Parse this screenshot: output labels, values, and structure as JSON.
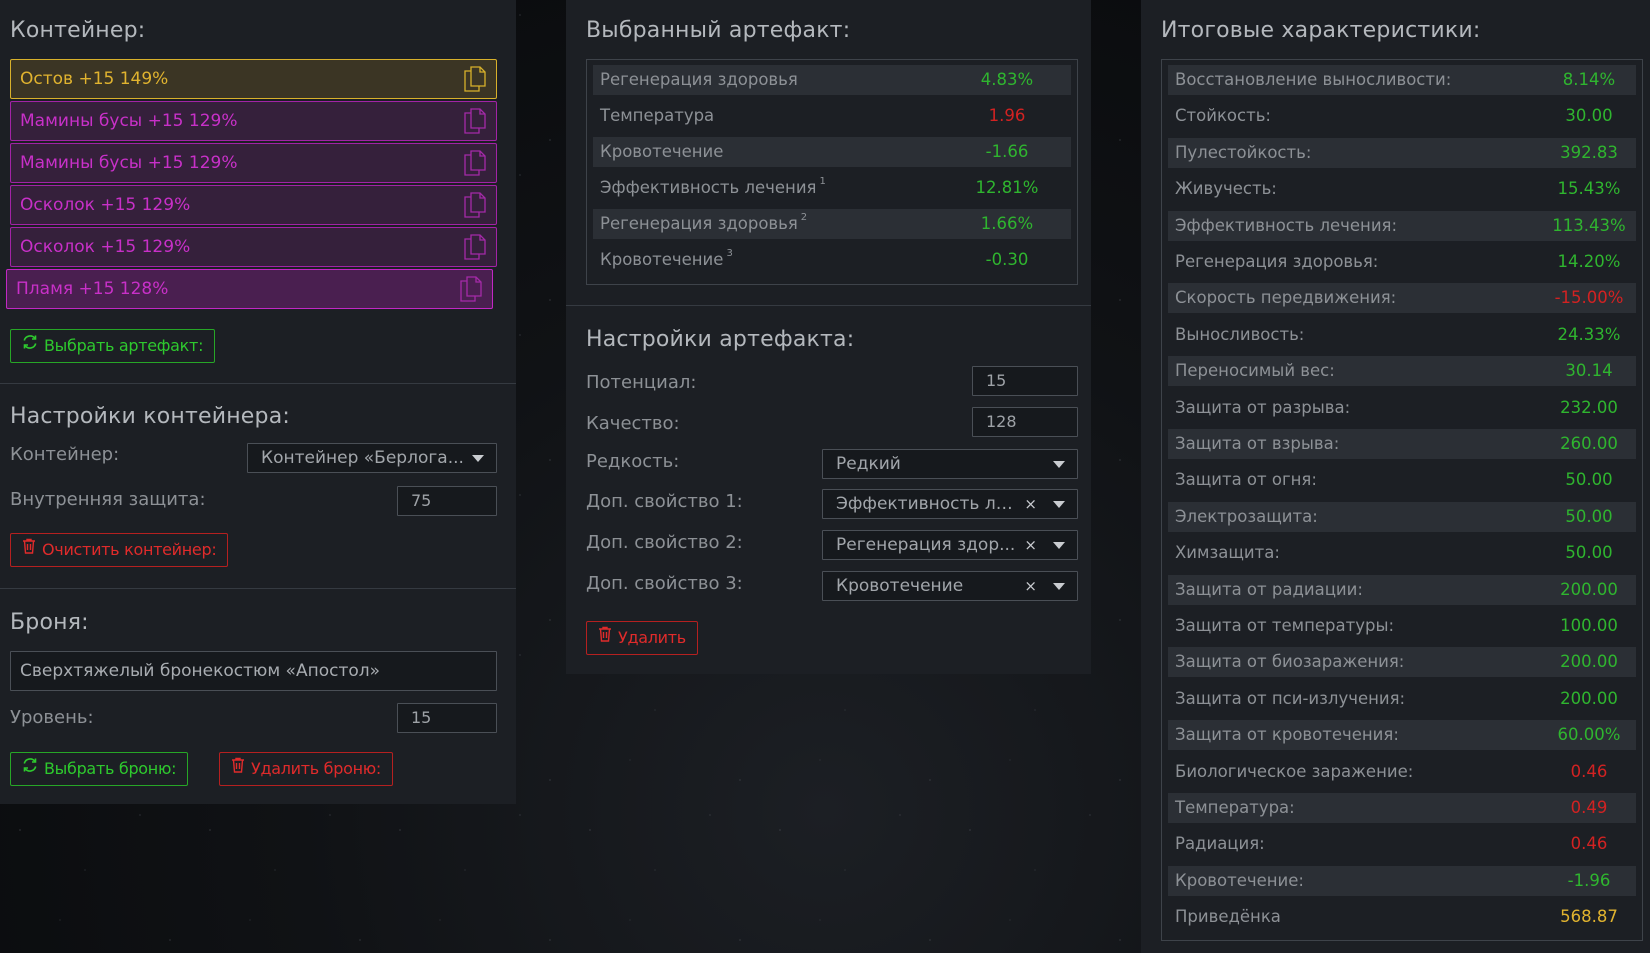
{
  "container": {
    "heading": "Контейнер:",
    "artifacts": [
      {
        "name": "Остов +15 149%",
        "rarity": "legendary"
      },
      {
        "name": "Мамины бусы +15 129%",
        "rarity": "epic"
      },
      {
        "name": "Мамины бусы +15 129%",
        "rarity": "epic"
      },
      {
        "name": "Осколок +15 129%",
        "rarity": "epic"
      },
      {
        "name": "Осколок +15 129%",
        "rarity": "epic"
      },
      {
        "name": "Пламя +15 128%",
        "rarity": "epic",
        "selected": true
      }
    ],
    "select_button": "Выбрать артефакт:"
  },
  "container_settings": {
    "heading": "Настройки контейнера:",
    "container_label": "Контейнер:",
    "container_value": "Контейнер «Берлога...",
    "inner_protection_label": "Внутренняя защита:",
    "inner_protection_value": "75",
    "clear_button": "Очистить контейнер:"
  },
  "armor": {
    "heading": "Броня:",
    "name_value": "Сверхтяжелый бронекостюм «Апостол»",
    "level_label": "Уровень:",
    "level_value": "15",
    "select_button": "Выбрать броню:",
    "delete_button": "Удалить броню:"
  },
  "selected_artifact": {
    "heading": "Выбранный артефакт:",
    "stats": [
      {
        "label": "Регенерация здоровья",
        "sup": "",
        "value": "4.83%",
        "sign": "pos"
      },
      {
        "label": "Температура",
        "sup": "",
        "value": "1.96",
        "sign": "neg"
      },
      {
        "label": "Кровотечение",
        "sup": "",
        "value": "-1.66",
        "sign": "pos"
      },
      {
        "label": "Эффективность лечения",
        "sup": "1",
        "value": "12.81%",
        "sign": "pos"
      },
      {
        "label": "Регенерация здоровья",
        "sup": "2",
        "value": "1.66%",
        "sign": "pos"
      },
      {
        "label": "Кровотечение",
        "sup": "3",
        "value": "-0.30",
        "sign": "pos"
      }
    ]
  },
  "artifact_settings": {
    "heading": "Настройки артефакта:",
    "potential_label": "Потенциал:",
    "potential_value": "15",
    "quality_label": "Качество:",
    "quality_value": "128",
    "rarity_label": "Редкость:",
    "rarity_value": "Редкий",
    "extra1_label": "Доп. свойство 1:",
    "extra1_value": "Эффективность ле...",
    "extra2_label": "Доп. свойство 2:",
    "extra2_value": "Регенерация здор...",
    "extra3_label": "Доп. свойство 3:",
    "extra3_value": "Кровотечение",
    "clear_symbol": "×",
    "delete_button": "Удалить"
  },
  "totals": {
    "heading": "Итоговые характеристики:",
    "stats": [
      {
        "label": "Восстановление выносливости:",
        "value": "8.14%",
        "sign": "pos"
      },
      {
        "label": "Стойкость:",
        "value": "30.00",
        "sign": "pos"
      },
      {
        "label": "Пулестойкость:",
        "value": "392.83",
        "sign": "pos"
      },
      {
        "label": "Живучесть:",
        "value": "15.43%",
        "sign": "pos"
      },
      {
        "label": "Эффективность лечения:",
        "value": "113.43%",
        "sign": "pos"
      },
      {
        "label": "Регенерация здоровья:",
        "value": "14.20%",
        "sign": "pos"
      },
      {
        "label": "Скорость передвижения:",
        "value": "-15.00%",
        "sign": "neg"
      },
      {
        "label": "Выносливость:",
        "value": "24.33%",
        "sign": "pos"
      },
      {
        "label": "Переносимый вес:",
        "value": "30.14",
        "sign": "pos"
      },
      {
        "label": "Защита от разрыва:",
        "value": "232.00",
        "sign": "pos"
      },
      {
        "label": "Защита от взрыва:",
        "value": "260.00",
        "sign": "pos"
      },
      {
        "label": "Защита от огня:",
        "value": "50.00",
        "sign": "pos"
      },
      {
        "label": "Электрозащита:",
        "value": "50.00",
        "sign": "pos"
      },
      {
        "label": "Химзащита:",
        "value": "50.00",
        "sign": "pos"
      },
      {
        "label": "Защита от радиации:",
        "value": "200.00",
        "sign": "pos"
      },
      {
        "label": "Защита от температуры:",
        "value": "100.00",
        "sign": "pos"
      },
      {
        "label": "Защита от биозаражения:",
        "value": "200.00",
        "sign": "pos"
      },
      {
        "label": "Защита от пси-излучения:",
        "value": "200.00",
        "sign": "pos"
      },
      {
        "label": "Защита от кровотечения:",
        "value": "60.00%",
        "sign": "pos"
      },
      {
        "label": "Биологическое заражение:",
        "value": "0.46",
        "sign": "neg"
      },
      {
        "label": "Температура:",
        "value": "0.49",
        "sign": "neg"
      },
      {
        "label": "Радиация:",
        "value": "0.46",
        "sign": "neg"
      },
      {
        "label": "Кровотечение:",
        "value": "-1.96",
        "sign": "pos"
      },
      {
        "label": "Приведёнка",
        "value": "568.87",
        "sign": "gold"
      }
    ]
  },
  "colors": {
    "positive": "#2fb52f",
    "negative": "#d22222",
    "legendary": "#e0b32f",
    "epic": "#c830c8"
  }
}
